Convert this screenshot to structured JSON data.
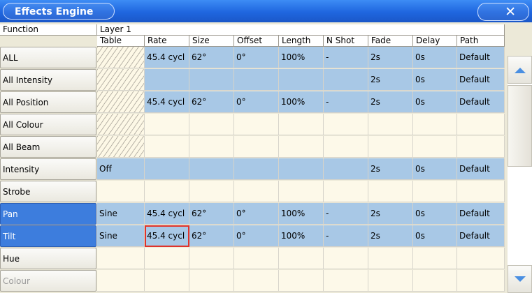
{
  "window": {
    "title": "Effects Engine"
  },
  "header": {
    "function_label": "Function",
    "layer_label": "Layer 1",
    "columns": [
      "Table",
      "Rate",
      "Size",
      "Offset",
      "Length",
      "N Shot",
      "Fade",
      "Delay",
      "Path"
    ]
  },
  "rows": [
    {
      "label": "ALL",
      "fill": "blue",
      "selected": false,
      "dim": false,
      "hatch": true,
      "cells": [
        "",
        "45.4 cycl",
        "62°",
        "0°",
        "100%",
        "-",
        "2s",
        "0s",
        "Default"
      ]
    },
    {
      "label": "All Intensity",
      "fill": "blue",
      "selected": false,
      "dim": false,
      "hatch": true,
      "cells": [
        "",
        "",
        "",
        "",
        "",
        "",
        "2s",
        "0s",
        "Default"
      ]
    },
    {
      "label": "All Position",
      "fill": "blue",
      "selected": false,
      "dim": false,
      "hatch": true,
      "cells": [
        "",
        "45.4 cycl",
        "62°",
        "0°",
        "100%",
        "-",
        "2s",
        "0s",
        "Default"
      ]
    },
    {
      "label": "All Colour",
      "fill": "cream",
      "selected": false,
      "dim": false,
      "hatch": true,
      "cells": [
        "",
        "",
        "",
        "",
        "",
        "",
        "",
        "",
        ""
      ]
    },
    {
      "label": "All Beam",
      "fill": "cream",
      "selected": false,
      "dim": false,
      "hatch": true,
      "cells": [
        "",
        "",
        "",
        "",
        "",
        "",
        "",
        "",
        ""
      ]
    },
    {
      "label": "Intensity",
      "fill": "blue",
      "selected": false,
      "dim": false,
      "hatch": false,
      "cells": [
        "Off",
        "",
        "",
        "",
        "",
        "",
        "2s",
        "0s",
        "Default"
      ]
    },
    {
      "label": "Strobe",
      "fill": "cream",
      "selected": false,
      "dim": false,
      "hatch": false,
      "cells": [
        "",
        "",
        "",
        "",
        "",
        "",
        "",
        "",
        ""
      ]
    },
    {
      "label": "Pan",
      "fill": "blue",
      "selected": true,
      "dim": false,
      "hatch": false,
      "cells": [
        "Sine",
        "45.4 cycl",
        "62°",
        "0°",
        "100%",
        "-",
        "2s",
        "0s",
        "Default"
      ]
    },
    {
      "label": "Tilt",
      "fill": "blue",
      "selected": true,
      "dim": false,
      "hatch": false,
      "cells": [
        "Sine",
        "45.4 cycl",
        "62°",
        "0°",
        "100%",
        "-",
        "2s",
        "0s",
        "Default"
      ]
    },
    {
      "label": "Hue",
      "fill": "cream",
      "selected": false,
      "dim": false,
      "hatch": false,
      "cells": [
        "",
        "",
        "",
        "",
        "",
        "",
        "",
        "",
        ""
      ]
    },
    {
      "label": "Colour",
      "fill": "cream",
      "selected": false,
      "dim": true,
      "hatch": false,
      "cells": [
        "",
        "",
        "",
        "",
        "",
        "",
        "",
        "",
        ""
      ]
    }
  ],
  "highlight": {
    "row": 8,
    "col": 1
  },
  "colors": {
    "row_blue": "#a8c8e6",
    "row_cream": "#fdf9e9",
    "selected": "#3d7ddd",
    "highlight": "#e0332a"
  },
  "icons": {
    "close": "close-icon",
    "scroll_up": "chevron-up-icon",
    "scroll_down": "chevron-down-icon"
  }
}
